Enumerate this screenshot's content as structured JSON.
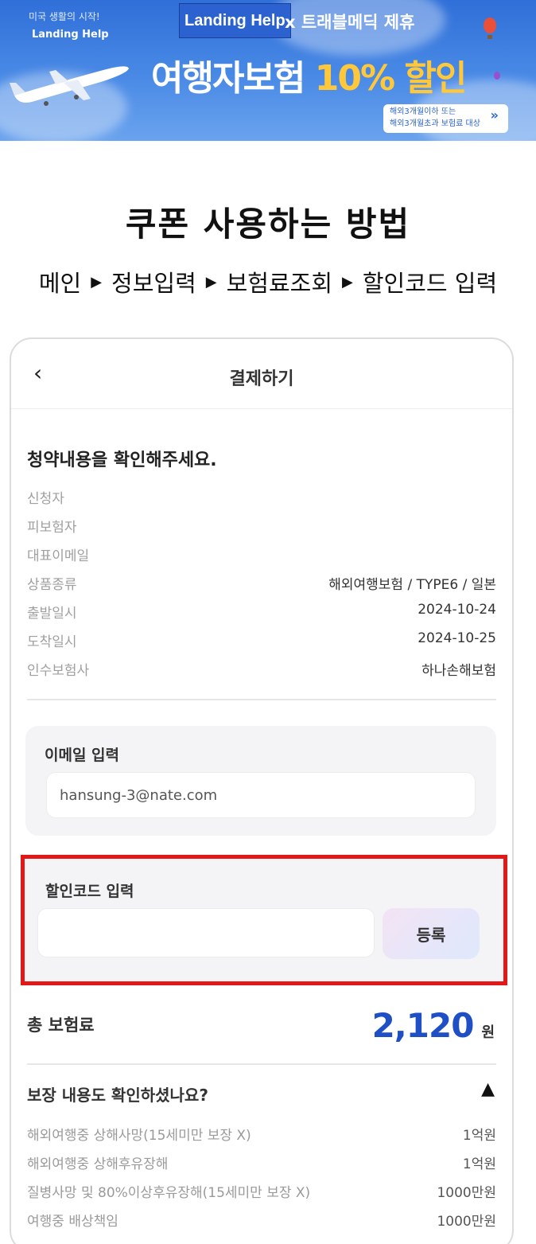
{
  "banner": {
    "tagline": "미국 생활의 시작!",
    "brand": "Landing Help",
    "partner_brand": "Landing Help",
    "partner_rest": "x 트래블메딕 제휴",
    "headline_main": "여행자보험 ",
    "headline_highlight": "10% 할인",
    "sub_line1": "해외3개월이하 또는",
    "sub_line2": "해외3개월초과 보험료 대상",
    "sub_arrow": "»"
  },
  "howto": {
    "title": "쿠폰 사용하는 방법",
    "steps": [
      "메인",
      "정보입력",
      "보험료조회",
      "할인코드 입력"
    ],
    "separator": "▶"
  },
  "screen": {
    "back_icon": "‹",
    "title": "결제하기",
    "confirm_title": "청약내용을 확인해주세요.",
    "info": [
      {
        "label": "신청자",
        "value": ""
      },
      {
        "label": "피보험자",
        "value": ""
      },
      {
        "label": "대표이메일",
        "value": ""
      },
      {
        "label": "상품종류",
        "value": "해외여행보험 / TYPE6 / 일본"
      },
      {
        "label": "출발일시",
        "value": "2024-10-24"
      },
      {
        "label": "도착일시",
        "value": "2024-10-25"
      },
      {
        "label": "인수보험사",
        "value": "하나손해보험"
      }
    ],
    "email": {
      "label": "이메일 입력",
      "value": "hansung-3@nate.com"
    },
    "coupon": {
      "label": "할인코드 입력",
      "value": "",
      "button": "등록"
    },
    "total": {
      "label": "총 보험료",
      "amount": "2,120",
      "unit": "원"
    },
    "coverage": {
      "title": "보장 내용도 확인하셨나요?",
      "toggle_icon": "▲",
      "items": [
        {
          "label": "해외여행중 상해사망(15세미만 보장 X)",
          "value": "1억원"
        },
        {
          "label": "해외여행중 상해후유장해",
          "value": "1억원"
        },
        {
          "label": "질병사망 및 80%이상후유장해(15세미만 보장 X)",
          "value": "1000만원"
        },
        {
          "label": "여행중 배상책임",
          "value": "1000만원"
        }
      ]
    }
  },
  "colors": {
    "banner_blue": "#2f6fd8",
    "highlight_yellow": "#ffc83a",
    "price_blue": "#1f4fc4",
    "coupon_border_red": "#e01818"
  }
}
